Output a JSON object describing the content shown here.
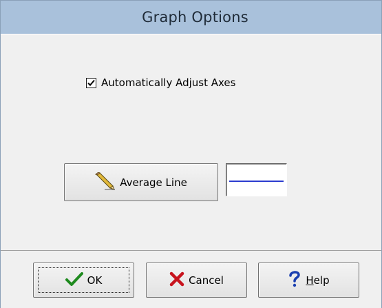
{
  "window": {
    "title": "Graph Options"
  },
  "options": {
    "auto_adjust": {
      "label": "Automatically Adjust Axes",
      "checked": true
    }
  },
  "average_line": {
    "button_label": "Average Line",
    "icon": "pencil-icon",
    "line_color": "#2b3ccf"
  },
  "buttons": {
    "ok": {
      "label": "OK",
      "icon": "checkmark-icon"
    },
    "cancel": {
      "label": "Cancel",
      "icon": "x-icon"
    },
    "help": {
      "label_first": "H",
      "label_rest": "elp",
      "icon": "question-icon"
    }
  }
}
